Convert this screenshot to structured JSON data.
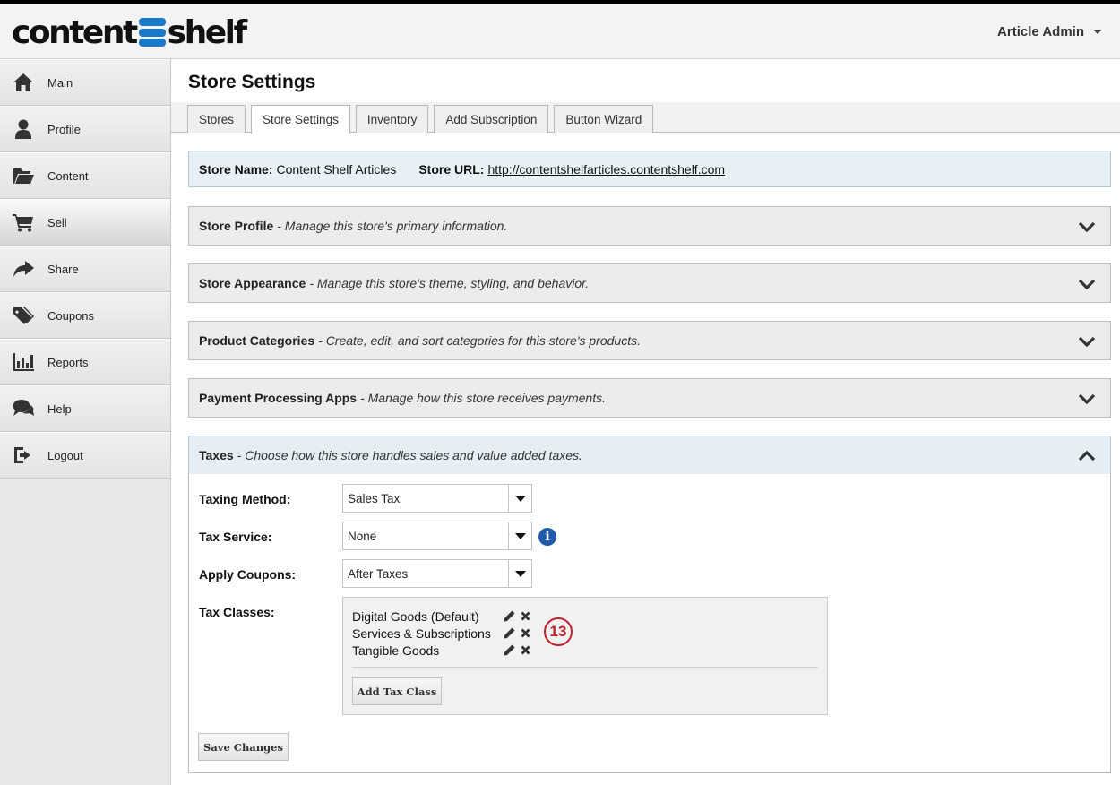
{
  "header": {
    "logo_left": "content",
    "logo_right": "shelf",
    "user_name": "Article Admin"
  },
  "sidebar": {
    "items": [
      {
        "label": "Main",
        "icon": "home-icon"
      },
      {
        "label": "Profile",
        "icon": "user-icon"
      },
      {
        "label": "Content",
        "icon": "folder-icon"
      },
      {
        "label": "Sell",
        "icon": "cart-icon"
      },
      {
        "label": "Share",
        "icon": "share-icon"
      },
      {
        "label": "Coupons",
        "icon": "tags-icon"
      },
      {
        "label": "Reports",
        "icon": "bar-chart-icon"
      },
      {
        "label": "Help",
        "icon": "chat-icon"
      },
      {
        "label": "Logout",
        "icon": "logout-icon"
      }
    ],
    "active": "Sell"
  },
  "page": {
    "title": "Store Settings",
    "tabs": [
      {
        "label": "Stores"
      },
      {
        "label": "Store Settings"
      },
      {
        "label": "Inventory"
      },
      {
        "label": "Add Subscription"
      },
      {
        "label": "Button Wizard"
      }
    ],
    "active_tab": "Store Settings"
  },
  "store": {
    "name_label": "Store Name:",
    "name": "Content Shelf Articles",
    "url_label": "Store URL:",
    "url": "http://contentshelfarticles.contentshelf.com"
  },
  "sections": [
    {
      "title": "Store Profile",
      "desc": "- Manage this store's primary information."
    },
    {
      "title": "Store Appearance",
      "desc": "- Manage this store's theme, styling, and behavior."
    },
    {
      "title": "Product Categories",
      "desc": "- Create, edit, and sort categories for this store's products."
    },
    {
      "title": "Payment Processing Apps",
      "desc": "- Manage how this store receives payments."
    },
    {
      "title": "Taxes",
      "desc": "- Choose how this store handles sales and value added taxes."
    }
  ],
  "taxes": {
    "method_label": "Taxing Method:",
    "method_value": "Sales Tax",
    "service_label": "Tax Service:",
    "service_value": "None",
    "coupons_label": "Apply Coupons:",
    "coupons_value": "After Taxes",
    "classes_label": "Tax Classes:",
    "classes": [
      {
        "name": "Digital Goods (Default)"
      },
      {
        "name": "Services & Subscriptions"
      },
      {
        "name": "Tangible Goods"
      }
    ],
    "classes_count": "13",
    "add_class_label": "Add Tax Class",
    "save_label": "Save Changes"
  },
  "colors": {
    "brand_blue": "#1a7ac9",
    "badge_red": "#c0202a",
    "info_blue": "#1f5ba8",
    "panel_blue": "#e7f0f5"
  }
}
